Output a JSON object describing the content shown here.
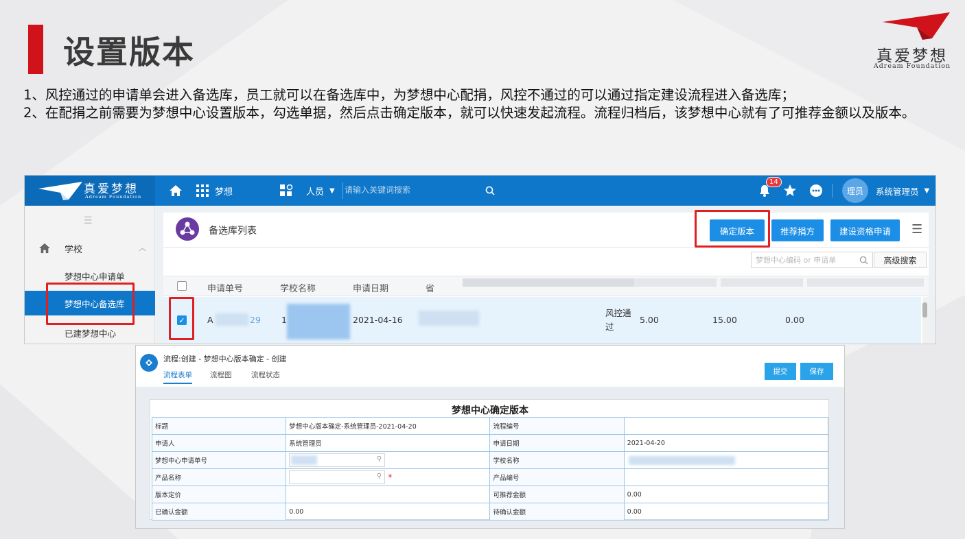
{
  "slide": {
    "title": "设置版本",
    "brand_name": "真爱梦想",
    "brand_sub": "Adream Foundation",
    "para1": "1、风控通过的申请单会进入备选库，员工就可以在备选库中，为梦想中心配捐，风控不通过的可以通过指定建设流程进入备选库；",
    "para2": "2、在配捐之前需要为梦想中心设置版本，勾选单据，然后点击确定版本，就可以快速发起流程。流程归档后，该梦想中心就有了可推荐金额以及版本。"
  },
  "app": {
    "logo_text": "真爱梦想",
    "logo_sub": "Adream Foundation",
    "nav_dream": "梦想",
    "people_select": "人员",
    "search_placeholder": "请输入关键词搜索",
    "notification_count": "14",
    "avatar_text": "理员",
    "user_name": "系统管理员",
    "sidebar": {
      "group": "学校",
      "items": [
        {
          "label": "梦想中心申请单"
        },
        {
          "label": "梦想中心备选库"
        },
        {
          "label": "已建梦想中心"
        }
      ]
    },
    "panel": {
      "title": "备选库列表",
      "buttons": {
        "confirm": "确定版本",
        "recommend": "推荐捐方",
        "build": "建设资格申请"
      },
      "filter_placeholder": "梦想中心编码 or 申请单",
      "advanced_search": "高级搜索",
      "columns": [
        "申请单号",
        "学校名称",
        "申请日期",
        "省"
      ],
      "row": {
        "id_prefix": "A",
        "id_suffix": "29",
        "school_prefix": "1",
        "date": "2021-04-16",
        "risk_status": "风控通过",
        "v1": "5.00",
        "v2": "15.00",
        "v3": "0.00"
      }
    }
  },
  "form": {
    "title": "流程:创建 - 梦想中心版本确定 - 创建",
    "tabs": [
      "流程表单",
      "流程图",
      "流程状态"
    ],
    "submit": "提交",
    "save": "保存",
    "heading": "梦想中心确定版本",
    "rows": [
      {
        "l1": "标题",
        "v1": "梦想中心版本确定-系统管理员-2021-04-20",
        "l2": "流程编号",
        "v2": ""
      },
      {
        "l1": "申请人",
        "v1": "系统管理员",
        "l2": "申请日期",
        "v2": "2021-04-20"
      },
      {
        "l1": "梦想中心申请单号",
        "v1": "",
        "l2": "学校名称",
        "v2": ""
      },
      {
        "l1": "产品名称",
        "v1": "",
        "l2": "产品编号",
        "v2": ""
      },
      {
        "l1": "版本定价",
        "v1": "",
        "l2": "可推荐金额",
        "v2": "0.00"
      },
      {
        "l1": "已确认金额",
        "v1": "0.00",
        "l2": "待确认金额",
        "v2": "0.00"
      }
    ],
    "required_mark": "*"
  },
  "colors": {
    "accent_red": "#d0121b",
    "app_blue": "#0f77c9",
    "button_blue": "#1d8ee6",
    "highlight_red": "#e02020"
  }
}
